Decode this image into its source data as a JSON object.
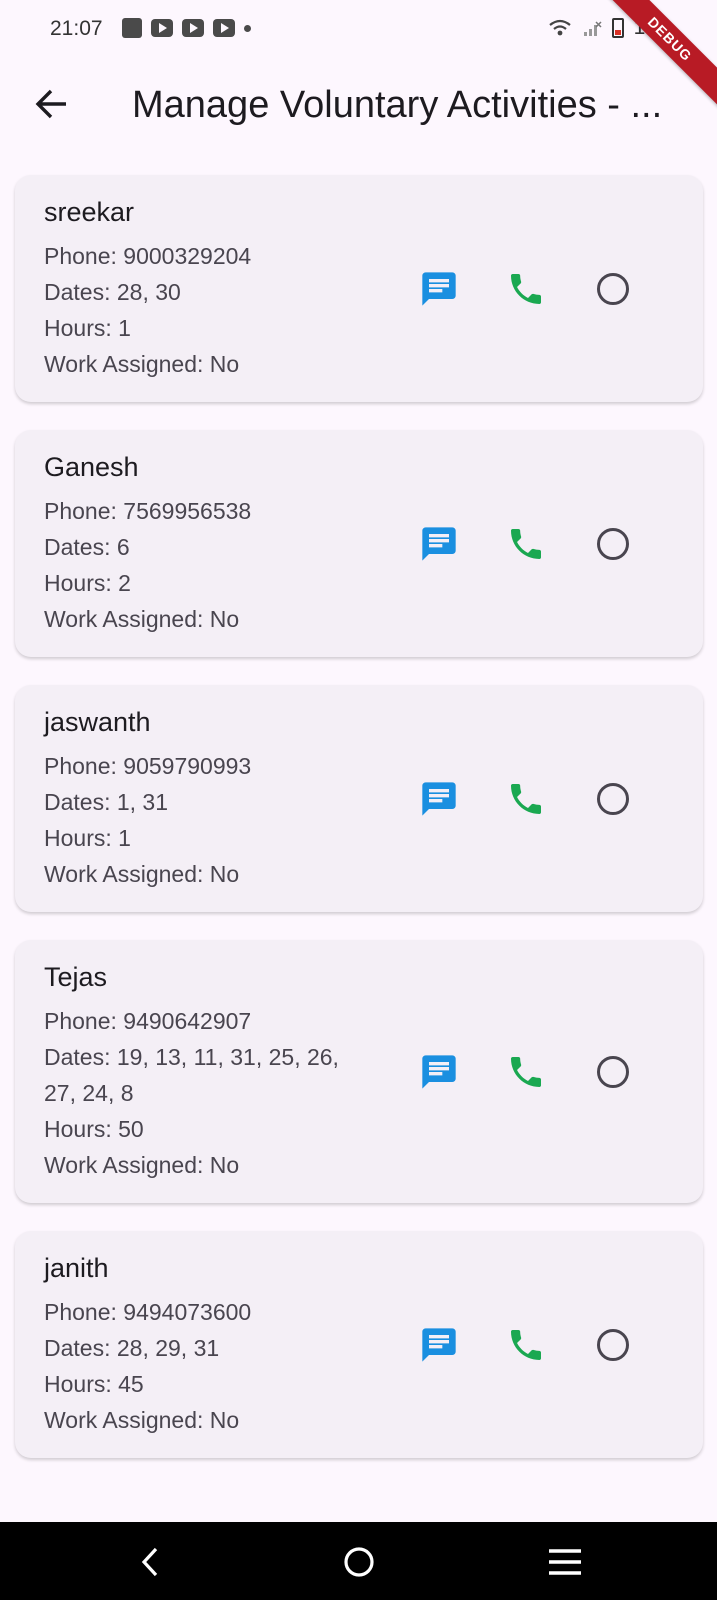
{
  "status_bar": {
    "time": "21:07",
    "battery": "17"
  },
  "debug_banner": "DEBUG",
  "app_bar": {
    "title": "Manage Voluntary Activities - ..."
  },
  "volunteers": [
    {
      "name": "sreekar",
      "phone": "Phone: 9000329204",
      "dates": "Dates: 28, 30",
      "hours": "Hours: 1",
      "work": "Work Assigned: No"
    },
    {
      "name": "Ganesh",
      "phone": "Phone: 7569956538",
      "dates": "Dates: 6",
      "hours": "Hours: 2",
      "work": "Work Assigned: No"
    },
    {
      "name": "jaswanth",
      "phone": "Phone: 9059790993",
      "dates": "Dates: 1, 31",
      "hours": "Hours: 1",
      "work": "Work Assigned: No"
    },
    {
      "name": "Tejas",
      "phone": "Phone: 9490642907",
      "dates": "Dates: 19, 13, 11, 31, 25, 26, 27, 24, 8",
      "hours": "Hours: 50",
      "work": "Work Assigned: No"
    },
    {
      "name": "janith",
      "phone": "Phone: 9494073600",
      "dates": "Dates: 28, 29, 31",
      "hours": "Hours: 45",
      "work": "Work Assigned: No"
    }
  ],
  "icons": {
    "message": "message-icon",
    "phone": "phone-icon",
    "select": "radio-unchecked-icon"
  },
  "colors": {
    "message": "#1a8fe0",
    "phone": "#1aa851",
    "background": "#fdf7fe",
    "card": "#f4eff6"
  }
}
